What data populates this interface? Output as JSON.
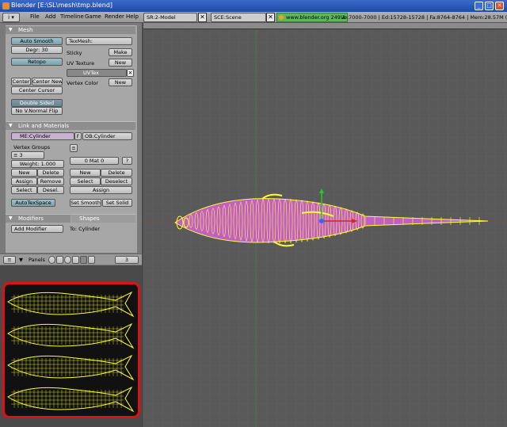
{
  "window": {
    "title": "Blender [E:\\SL\\mesh\\tmp.blend]",
    "minimize": "_",
    "maximize": "□",
    "close": "✕"
  },
  "menubar": {
    "editor_icon": "i ▾",
    "items": [
      "File",
      "Add",
      "Timeline",
      "Game",
      "Render",
      "Help"
    ],
    "screen_name": "SR:2-Model",
    "scene_name": "SCE:Scene",
    "site": "www.blender.org 249.2",
    "stats": "Ve:7000-7000 | Ed:15728-15728 | Fa:8764-8764 | Mem:28.57M (8.49M"
  },
  "mesh_panel": {
    "title": "Mesh",
    "auto_smooth": "Auto Smooth",
    "degr": "Degr: 30",
    "retopo": "Retopo",
    "center": "Center",
    "center_new": "Center New",
    "center_cursor": "Center Cursor",
    "double_sided": "Double Sided",
    "no_v_normal_flip": "No V.Normal Flip",
    "texmesh": "TexMesh:",
    "sticky": "Sticky",
    "make": "Make",
    "uv_texture": "UV Texture",
    "uv_new": "New",
    "uvtex": "UVTex",
    "vertex_color": "Vertex Color",
    "vc_new": "New"
  },
  "link_panel": {
    "title": "Link and Materials",
    "me": "ME:Cylinder",
    "f": "F",
    "ob": "OB:Cylinder",
    "vertex_groups": "Vertex Groups",
    "vg_toggle": "≡",
    "vg_field": "≡ 3",
    "weight": "Weight: 1.000",
    "new": "New",
    "delete": "Delete",
    "assign": "Assign",
    "remove": "Remove",
    "select": "Select",
    "desel": "Desel.",
    "mat": "0 Mat 0",
    "mat_q": "?",
    "mat_new": "New",
    "mat_delete": "Delete",
    "mat_select": "Select",
    "mat_deselect": "Deselect",
    "mat_assign": "Assign",
    "autotexspace": "AutoTexSpace",
    "set_smooth": "Set Smooth",
    "set_solid": "Set Solid"
  },
  "modifiers_panel": {
    "tab_modifiers": "Modifiers",
    "tab_shapes": "Shapes",
    "add_modifier": "Add Modifier",
    "to": "To: Cylinder"
  },
  "left_header": {
    "panels": "Panels",
    "page": "3"
  },
  "colors": {
    "mesh_fill": "#c15fc4",
    "wire": "#ffff33",
    "highlight": "#e01010",
    "grid_bg": "#595959"
  }
}
